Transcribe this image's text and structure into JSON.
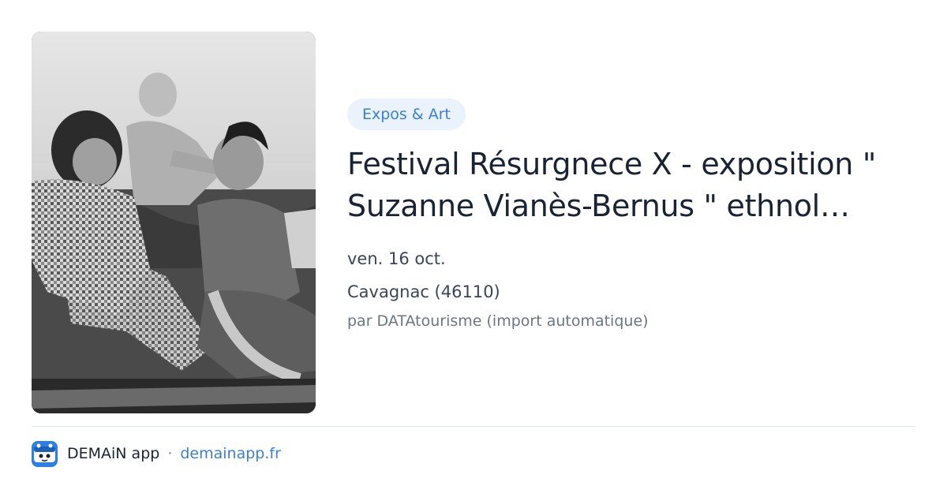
{
  "event": {
    "category": "Expos & Art",
    "title": "Festival Résurgnece X - exposition \"\nSuzanne Vianès-Bernus \" ethnol…",
    "date": "ven. 16 oct.",
    "location": "Cavagnac (46110)",
    "source": "par DATAtourisme (import automatique)"
  },
  "footer": {
    "app_name": "DEMAiN app",
    "separator": "·",
    "domain": "demainapp.fr"
  },
  "colors": {
    "accent": "#3b7fd4",
    "tag_background": "#eaf2fc",
    "title": "#1a2333",
    "app_icon": "#2c7fe6"
  }
}
